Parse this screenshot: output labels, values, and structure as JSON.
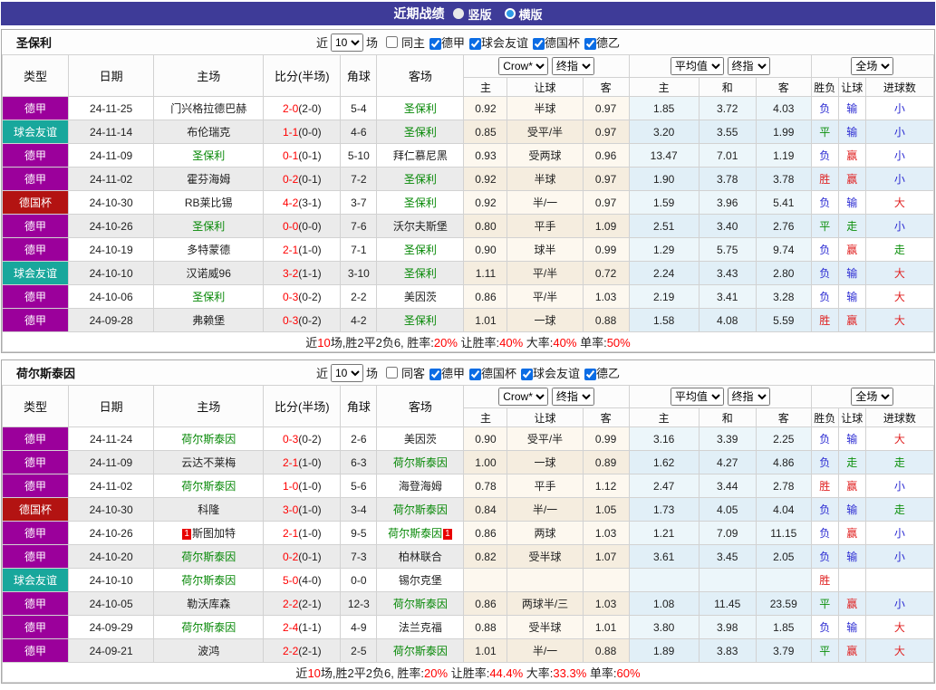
{
  "title_bar": {
    "title": "近期战绩",
    "options": [
      {
        "label": "竖版",
        "selected": false
      },
      {
        "label": "横版",
        "selected": true
      }
    ]
  },
  "colors": {
    "title_bar_bg": "#3E3B98",
    "types": {
      "德甲": "#9B009B",
      "球会友谊": "#18A79C",
      "德国杯": "#B31312"
    },
    "team_highlight_green": "#068806",
    "score_red": "#FF0000"
  },
  "table_header": {
    "type": "类型",
    "date": "日期",
    "home": "主场",
    "score": "比分(半场)",
    "corner": "角球",
    "away": "客场",
    "company_select": "Crow*",
    "final_select1": "终指",
    "average_select": "平均值",
    "final_select2": "终指",
    "fulltime_select": "全场",
    "odds_home": "主",
    "odds_handicap": "让球",
    "odds_away": "客",
    "avg_home": "主",
    "avg_draw": "和",
    "avg_away": "客",
    "result_wdl": "胜负",
    "result_handicap": "让球",
    "result_goals": "进球数"
  },
  "sections": [
    {
      "team": "圣保利",
      "filters": {
        "recent_label": "近",
        "count": "10",
        "games_label": "场",
        "same_label": "同主",
        "same_checked": false,
        "leagues": [
          {
            "label": "德甲",
            "checked": true
          },
          {
            "label": "球会友谊",
            "checked": true
          },
          {
            "label": "德国杯",
            "checked": true
          },
          {
            "label": "德乙",
            "checked": true
          }
        ]
      },
      "rows": [
        {
          "type": "德甲",
          "date": "24-11-25",
          "home": "门兴格拉德巴赫",
          "hg": 0,
          "hcard": "",
          "score": "2-0",
          "half": "(2-0)",
          "corner": "5-4",
          "away": "圣保利",
          "ag": 1,
          "acard": "",
          "o1": "0.92",
          "hcp": "半球",
          "o2": "0.97",
          "a1": "1.85",
          "a2": "3.72",
          "a3": "4.03",
          "r1": "负",
          "c1": "b",
          "r2": "输",
          "c2": "b",
          "r3": "小",
          "c3": "b"
        },
        {
          "type": "球会友谊",
          "date": "24-11-14",
          "home": "布伦瑞克",
          "hg": 0,
          "hcard": "",
          "score": "1-1",
          "half": "(0-0)",
          "corner": "4-6",
          "away": "圣保利",
          "ag": 1,
          "acard": "",
          "o1": "0.85",
          "hcp": "受平/半",
          "o2": "0.97",
          "a1": "3.20",
          "a2": "3.55",
          "a3": "1.99",
          "r1": "平",
          "c1": "g",
          "r2": "输",
          "c2": "b",
          "r3": "小",
          "c3": "b"
        },
        {
          "type": "德甲",
          "date": "24-11-09",
          "home": "圣保利",
          "hg": 1,
          "hcard": "",
          "score": "0-1",
          "half": "(0-1)",
          "corner": "5-10",
          "away": "拜仁慕尼黑",
          "ag": 0,
          "acard": "",
          "o1": "0.93",
          "hcp": "受两球",
          "o2": "0.96",
          "a1": "13.47",
          "a2": "7.01",
          "a3": "1.19",
          "r1": "负",
          "c1": "b",
          "r2": "赢",
          "c2": "r",
          "r3": "小",
          "c3": "b"
        },
        {
          "type": "德甲",
          "date": "24-11-02",
          "home": "霍芬海姆",
          "hg": 0,
          "hcard": "",
          "score": "0-2",
          "half": "(0-1)",
          "corner": "7-2",
          "away": "圣保利",
          "ag": 1,
          "acard": "",
          "o1": "0.92",
          "hcp": "半球",
          "o2": "0.97",
          "a1": "1.90",
          "a2": "3.78",
          "a3": "3.78",
          "r1": "胜",
          "c1": "r",
          "r2": "赢",
          "c2": "r",
          "r3": "小",
          "c3": "b"
        },
        {
          "type": "德国杯",
          "date": "24-10-30",
          "home": "RB莱比锡",
          "hg": 0,
          "hcard": "",
          "score": "4-2",
          "half": "(3-1)",
          "corner": "3-7",
          "away": "圣保利",
          "ag": 1,
          "acard": "",
          "o1": "0.92",
          "hcp": "半/一",
          "o2": "0.97",
          "a1": "1.59",
          "a2": "3.96",
          "a3": "5.41",
          "r1": "负",
          "c1": "b",
          "r2": "输",
          "c2": "b",
          "r3": "大",
          "c3": "r"
        },
        {
          "type": "德甲",
          "date": "24-10-26",
          "home": "圣保利",
          "hg": 1,
          "hcard": "",
          "score": "0-0",
          "half": "(0-0)",
          "corner": "7-6",
          "away": "沃尔夫斯堡",
          "ag": 0,
          "acard": "",
          "o1": "0.80",
          "hcp": "平手",
          "o2": "1.09",
          "a1": "2.51",
          "a2": "3.40",
          "a3": "2.76",
          "r1": "平",
          "c1": "g",
          "r2": "走",
          "c2": "g",
          "r3": "小",
          "c3": "b"
        },
        {
          "type": "德甲",
          "date": "24-10-19",
          "home": "多特蒙德",
          "hg": 0,
          "hcard": "",
          "score": "2-1",
          "half": "(1-0)",
          "corner": "7-1",
          "away": "圣保利",
          "ag": 1,
          "acard": "",
          "o1": "0.90",
          "hcp": "球半",
          "o2": "0.99",
          "a1": "1.29",
          "a2": "5.75",
          "a3": "9.74",
          "r1": "负",
          "c1": "b",
          "r2": "赢",
          "c2": "r",
          "r3": "走",
          "c3": "g"
        },
        {
          "type": "球会友谊",
          "date": "24-10-10",
          "home": "汉诺威96",
          "hg": 0,
          "hcard": "",
          "score": "3-2",
          "half": "(1-1)",
          "corner": "3-10",
          "away": "圣保利",
          "ag": 1,
          "acard": "",
          "o1": "1.11",
          "hcp": "平/半",
          "o2": "0.72",
          "a1": "2.24",
          "a2": "3.43",
          "a3": "2.80",
          "r1": "负",
          "c1": "b",
          "r2": "输",
          "c2": "b",
          "r3": "大",
          "c3": "r"
        },
        {
          "type": "德甲",
          "date": "24-10-06",
          "home": "圣保利",
          "hg": 1,
          "hcard": "",
          "score": "0-3",
          "half": "(0-2)",
          "corner": "2-2",
          "away": "美因茨",
          "ag": 0,
          "acard": "",
          "o1": "0.86",
          "hcp": "平/半",
          "o2": "1.03",
          "a1": "2.19",
          "a2": "3.41",
          "a3": "3.28",
          "r1": "负",
          "c1": "b",
          "r2": "输",
          "c2": "b",
          "r3": "大",
          "c3": "r"
        },
        {
          "type": "德甲",
          "date": "24-09-28",
          "home": "弗赖堡",
          "hg": 0,
          "hcard": "",
          "score": "0-3",
          "half": "(0-2)",
          "corner": "4-2",
          "away": "圣保利",
          "ag": 1,
          "acard": "",
          "o1": "1.01",
          "hcp": "一球",
          "o2": "0.88",
          "a1": "1.58",
          "a2": "4.08",
          "a3": "5.59",
          "r1": "胜",
          "c1": "r",
          "r2": "赢",
          "c2": "r",
          "r3": "大",
          "c3": "r"
        }
      ],
      "summary": [
        "近",
        "10",
        "场,胜2平2负6, 胜率:",
        "20%",
        " 让胜率:",
        "40%",
        " 大率:",
        "40%",
        " 单率:",
        "50%"
      ]
    },
    {
      "team": "荷尔斯泰因",
      "filters": {
        "recent_label": "近",
        "count": "10",
        "games_label": "场",
        "same_label": "同客",
        "same_checked": false,
        "leagues": [
          {
            "label": "德甲",
            "checked": true
          },
          {
            "label": "德国杯",
            "checked": true
          },
          {
            "label": "球会友谊",
            "checked": true
          },
          {
            "label": "德乙",
            "checked": true
          }
        ]
      },
      "rows": [
        {
          "type": "德甲",
          "date": "24-11-24",
          "home": "荷尔斯泰因",
          "hg": 1,
          "hcard": "",
          "score": "0-3",
          "half": "(0-2)",
          "corner": "2-6",
          "away": "美因茨",
          "ag": 0,
          "acard": "",
          "o1": "0.90",
          "hcp": "受平/半",
          "o2": "0.99",
          "a1": "3.16",
          "a2": "3.39",
          "a3": "2.25",
          "r1": "负",
          "c1": "b",
          "r2": "输",
          "c2": "b",
          "r3": "大",
          "c3": "r"
        },
        {
          "type": "德甲",
          "date": "24-11-09",
          "home": "云达不莱梅",
          "hg": 0,
          "hcard": "",
          "score": "2-1",
          "half": "(1-0)",
          "corner": "6-3",
          "away": "荷尔斯泰因",
          "ag": 1,
          "acard": "",
          "o1": "1.00",
          "hcp": "一球",
          "o2": "0.89",
          "a1": "1.62",
          "a2": "4.27",
          "a3": "4.86",
          "r1": "负",
          "c1": "b",
          "r2": "走",
          "c2": "g",
          "r3": "走",
          "c3": "g"
        },
        {
          "type": "德甲",
          "date": "24-11-02",
          "home": "荷尔斯泰因",
          "hg": 1,
          "hcard": "",
          "score": "1-0",
          "half": "(1-0)",
          "corner": "5-6",
          "away": "海登海姆",
          "ag": 0,
          "acard": "",
          "o1": "0.78",
          "hcp": "平手",
          "o2": "1.12",
          "a1": "2.47",
          "a2": "3.44",
          "a3": "2.78",
          "r1": "胜",
          "c1": "r",
          "r2": "赢",
          "c2": "r",
          "r3": "小",
          "c3": "b"
        },
        {
          "type": "德国杯",
          "date": "24-10-30",
          "home": "科隆",
          "hg": 0,
          "hcard": "",
          "score": "3-0",
          "half": "(1-0)",
          "corner": "3-4",
          "away": "荷尔斯泰因",
          "ag": 1,
          "acard": "",
          "o1": "0.84",
          "hcp": "半/一",
          "o2": "1.05",
          "a1": "1.73",
          "a2": "4.05",
          "a3": "4.04",
          "r1": "负",
          "c1": "b",
          "r2": "输",
          "c2": "b",
          "r3": "走",
          "c3": "g"
        },
        {
          "type": "德甲",
          "date": "24-10-26",
          "home": "斯图加特",
          "hg": 0,
          "hcard": "1",
          "score": "2-1",
          "half": "(1-0)",
          "corner": "9-5",
          "away": "荷尔斯泰因",
          "ag": 1,
          "acard": "1",
          "o1": "0.86",
          "hcp": "两球",
          "o2": "1.03",
          "a1": "1.21",
          "a2": "7.09",
          "a3": "11.15",
          "r1": "负",
          "c1": "b",
          "r2": "赢",
          "c2": "r",
          "r3": "小",
          "c3": "b"
        },
        {
          "type": "德甲",
          "date": "24-10-20",
          "home": "荷尔斯泰因",
          "hg": 1,
          "hcard": "",
          "score": "0-2",
          "half": "(0-1)",
          "corner": "7-3",
          "away": "柏林联合",
          "ag": 0,
          "acard": "",
          "o1": "0.82",
          "hcp": "受半球",
          "o2": "1.07",
          "a1": "3.61",
          "a2": "3.45",
          "a3": "2.05",
          "r1": "负",
          "c1": "b",
          "r2": "输",
          "c2": "b",
          "r3": "小",
          "c3": "b"
        },
        {
          "type": "球会友谊",
          "date": "24-10-10",
          "home": "荷尔斯泰因",
          "hg": 1,
          "hcard": "",
          "score": "5-0",
          "half": "(4-0)",
          "corner": "0-0",
          "away": "锡尔克堡",
          "ag": 0,
          "acard": "",
          "o1": "",
          "hcp": "",
          "o2": "",
          "a1": "",
          "a2": "",
          "a3": "",
          "r1": "胜",
          "c1": "r",
          "r2": "",
          "c2": "",
          "r3": "",
          "c3": ""
        },
        {
          "type": "德甲",
          "date": "24-10-05",
          "home": "勒沃库森",
          "hg": 0,
          "hcard": "",
          "score": "2-2",
          "half": "(2-1)",
          "corner": "12-3",
          "away": "荷尔斯泰因",
          "ag": 1,
          "acard": "",
          "o1": "0.86",
          "hcp": "两球半/三",
          "o2": "1.03",
          "a1": "1.08",
          "a2": "11.45",
          "a3": "23.59",
          "r1": "平",
          "c1": "g",
          "r2": "赢",
          "c2": "r",
          "r3": "小",
          "c3": "b"
        },
        {
          "type": "德甲",
          "date": "24-09-29",
          "home": "荷尔斯泰因",
          "hg": 1,
          "hcard": "",
          "score": "2-4",
          "half": "(1-1)",
          "corner": "4-9",
          "away": "法兰克福",
          "ag": 0,
          "acard": "",
          "o1": "0.88",
          "hcp": "受半球",
          "o2": "1.01",
          "a1": "3.80",
          "a2": "3.98",
          "a3": "1.85",
          "r1": "负",
          "c1": "b",
          "r2": "输",
          "c2": "b",
          "r3": "大",
          "c3": "r"
        },
        {
          "type": "德甲",
          "date": "24-09-21",
          "home": "波鸿",
          "hg": 0,
          "hcard": "",
          "score": "2-2",
          "half": "(2-1)",
          "corner": "2-5",
          "away": "荷尔斯泰因",
          "ag": 1,
          "acard": "",
          "o1": "1.01",
          "hcp": "半/一",
          "o2": "0.88",
          "a1": "1.89",
          "a2": "3.83",
          "a3": "3.79",
          "r1": "平",
          "c1": "g",
          "r2": "赢",
          "c2": "r",
          "r3": "大",
          "c3": "r"
        }
      ],
      "summary": [
        "近",
        "10",
        "场,胜2平2负6, 胜率:",
        "20%",
        " 让胜率:",
        "44.4%",
        " 大率:",
        "33.3%",
        " 单率:",
        "60%"
      ]
    }
  ]
}
